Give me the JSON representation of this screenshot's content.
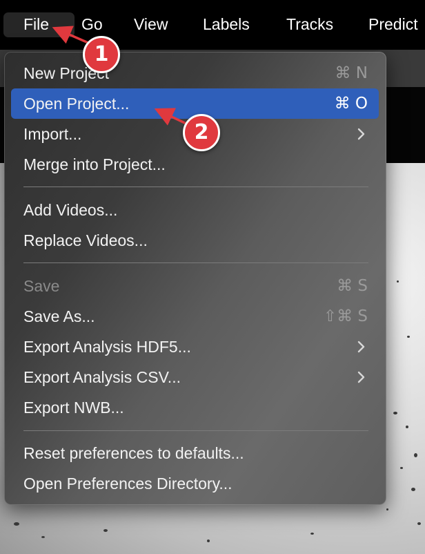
{
  "menubar": {
    "items": [
      {
        "label": "File",
        "active": true
      },
      {
        "label": "Go"
      },
      {
        "label": "View"
      },
      {
        "label": "Labels"
      },
      {
        "label": "Tracks"
      },
      {
        "label": "Predict"
      }
    ]
  },
  "file_menu": {
    "items": [
      {
        "label": "New Project",
        "shortcut": "⌘ N"
      },
      {
        "label": "Open Project...",
        "shortcut": "⌘ O",
        "highlighted": true
      },
      {
        "label": "Import...",
        "submenu": true
      },
      {
        "label": "Merge into Project..."
      },
      {
        "label": "Add Videos..."
      },
      {
        "label": "Replace Videos..."
      },
      {
        "label": "Save",
        "shortcut": "⌘ S",
        "disabled": true
      },
      {
        "label": "Save As...",
        "shortcut": "⇧⌘ S"
      },
      {
        "label": "Export Analysis HDF5...",
        "submenu": true
      },
      {
        "label": "Export Analysis CSV...",
        "submenu": true
      },
      {
        "label": "Export NWB..."
      },
      {
        "label": "Reset preferences to defaults..."
      },
      {
        "label": "Open Preferences Directory..."
      }
    ]
  },
  "annotations": {
    "step1": "1",
    "step2": "2",
    "color": "#e0393e"
  },
  "colors": {
    "highlight": "#2f5fba",
    "menubar": "#000000"
  }
}
